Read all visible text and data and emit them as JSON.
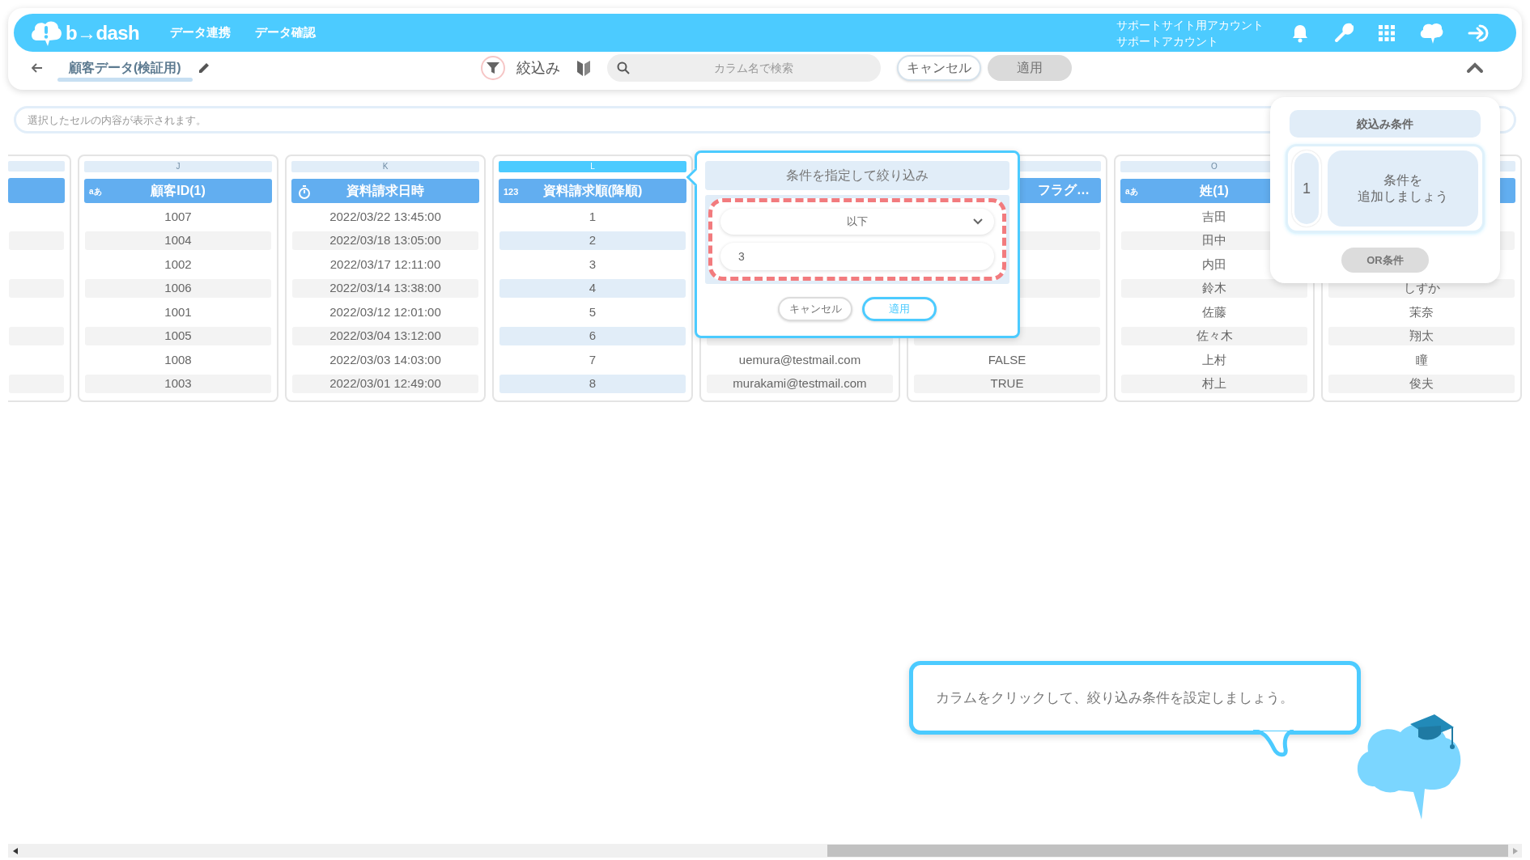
{
  "app_bar": {
    "logo": "b→dash",
    "nav": [
      "データ連携",
      "データ確認"
    ],
    "account": [
      "サポートサイト用アカウント",
      "サポートアカウント"
    ]
  },
  "toolbar": {
    "title": "顧客データ(検証用)",
    "filter_label": "絞込み",
    "search": {
      "placeholder": "カラム名で検索"
    },
    "buttons": [
      {
        "label": "キャンセル",
        "disabled": false
      },
      {
        "label": "適用",
        "disabled": true
      }
    ]
  },
  "cell_viewer": {
    "placeholder": "選択したセルの内容が表示されます。"
  },
  "columns": [
    {
      "kind": "clipped",
      "selected": false
    },
    {
      "kind": "text",
      "letter": "J",
      "type_label": "aあ",
      "header": "顧客ID(1)",
      "selected": false,
      "cells": [
        "1007",
        "1004",
        "1002",
        "1006",
        "1001",
        "1005",
        "1008",
        "1003"
      ]
    },
    {
      "kind": "datetime",
      "letter": "K",
      "header": "資料請求日時",
      "selected": false,
      "cells": [
        "2022/03/22 13:45:00",
        "2022/03/18 13:05:00",
        "2022/03/17 12:11:00",
        "2022/03/14 13:38:00",
        "2022/03/12 12:01:00",
        "2022/03/04 13:12:00",
        "2022/03/03 14:03:00",
        "2022/03/01 12:49:00"
      ]
    },
    {
      "kind": "number",
      "letter": "L",
      "type_label": "123",
      "header": "資料請求順(降順)",
      "selected": true,
      "cells": [
        "1",
        "2",
        "3",
        "4",
        "5",
        "6",
        "7",
        "8"
      ]
    },
    {
      "kind": "plain",
      "selected": false,
      "cells": [
        null,
        null,
        null,
        null,
        null,
        null,
        "uemura@testmail.com",
        "murakami@testmail.com"
      ]
    },
    {
      "kind": "plain",
      "header": "フラグ…",
      "selected": false,
      "cells": [
        null,
        null,
        null,
        null,
        null,
        null,
        "FALSE",
        "TRUE"
      ]
    },
    {
      "kind": "text",
      "letter": "O",
      "type_label": "aあ",
      "header": "姓(1)",
      "selected": false,
      "cells": [
        "吉田",
        "田中",
        "内田",
        "鈴木",
        "佐藤",
        "佐々木",
        "上村",
        "村上"
      ]
    },
    {
      "kind": "plain",
      "selected": false,
      "cells": [
        null,
        null,
        null,
        "しずか",
        "茉奈",
        "翔太",
        "瞳",
        "俊夫"
      ]
    }
  ],
  "filter_popover": {
    "title": "条件を指定して絞り込み",
    "operator": "以下",
    "value": "3",
    "buttons": [
      {
        "label": "キャンセル",
        "primary": false
      },
      {
        "label": "適用",
        "primary": true
      }
    ]
  },
  "conditions_panel": {
    "title": "絞込み条件",
    "conditions": [
      {
        "number": "1",
        "lines": [
          "条件を",
          "追加しましょう"
        ]
      }
    ],
    "or_button": {
      "label": "OR条件",
      "disabled": true
    }
  },
  "hint": {
    "text": "カラムをクリックして、絞り込み条件を設定しましょう。"
  }
}
